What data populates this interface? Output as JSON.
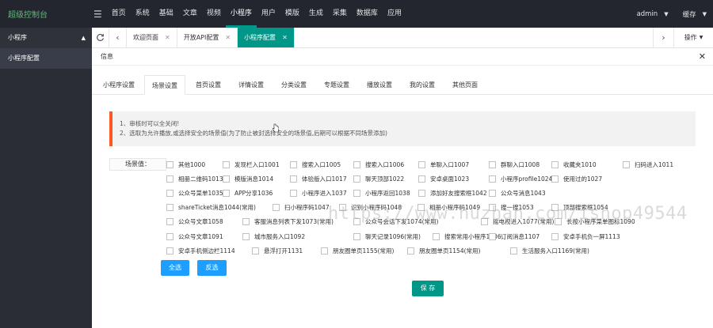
{
  "topbar": {
    "brand": "超级控制台",
    "menu_icon": "menu-icon",
    "nav": [
      {
        "label": "首页"
      },
      {
        "label": "系统"
      },
      {
        "label": "基础"
      },
      {
        "label": "文章"
      },
      {
        "label": "视频"
      },
      {
        "label": "小程序"
      },
      {
        "label": "用户"
      },
      {
        "label": "模版"
      },
      {
        "label": "生成"
      },
      {
        "label": "采集"
      },
      {
        "label": "数据库"
      },
      {
        "label": "应用"
      }
    ],
    "active_nav": "小程序",
    "user": "admin",
    "cache": "缓存"
  },
  "sidebar": {
    "group": "小程序",
    "items": [
      {
        "label": "小程序配置"
      }
    ]
  },
  "tabbar": {
    "tabs": [
      {
        "label": "欢迎页面"
      },
      {
        "label": "开放API配置"
      },
      {
        "label": "小程序配置"
      }
    ],
    "active_tab": "小程序配置",
    "ops": "操作"
  },
  "panel": {
    "title": "信息",
    "subtabs": [
      {
        "label": "小程序设置"
      },
      {
        "label": "场景设置"
      },
      {
        "label": "首页设置"
      },
      {
        "label": "详情设置"
      },
      {
        "label": "分类设置"
      },
      {
        "label": "专题设置"
      },
      {
        "label": "播放设置"
      },
      {
        "label": "我的设置"
      },
      {
        "label": "其他页面"
      }
    ],
    "active_subtab": "场景设置",
    "notice": [
      "1、审核时可以全关闭!",
      "2、选取为允许播放,或选择安全的场景值(为了防止被封选择安全的场景值,后期可以根据不同场景添加)"
    ],
    "field_label": "场景值：",
    "scenes": [
      [
        "其他1000",
        "发现栏入口1001",
        "搜索入口1005",
        "搜索入口1006",
        "单聊入口1007",
        "群聊入口1008",
        "收藏夹1010",
        "扫码进入1011"
      ],
      [
        "相册二维码1013",
        "模版消息1014",
        "体验版入口1017",
        "聊天顶部1022",
        "安卓桌面1023",
        "小程序profile1024",
        "使用过的1027"
      ],
      [
        "公众号菜单1035",
        "APP分享1036",
        "小程序进入1037",
        "小程序返回1038",
        "添加好友搜索框1042",
        "公众号消息1043"
      ],
      [
        "shareTicket消息1044(常用)",
        "扫小程序码1047",
        "识别小程序码1048",
        "相册小程序码1049",
        "搜一搜1053",
        "顶部搜索框1054"
      ],
      [
        "公众号文章1058",
        "客服消息列表下发1073(常用)",
        "公众号会话下发1074(常用)",
        "摇电视进入1077(常用)",
        "长按小程序菜单图标1090"
      ],
      [
        "公众号文章1091",
        "城市服务入口1092",
        "聊天记录1096(常用)",
        "搜索常用小程序1106",
        "订阅消息1107",
        "安卓手机负一屏1113"
      ],
      [
        "安卓手机侧边栏1114",
        "悬浮打开1131",
        "朋友圈单页1155(常用)",
        "朋友圈单页1154(常用)",
        "生活服务入口1169(常用)"
      ]
    ],
    "select_all": "全选",
    "invert": "反选",
    "save": "保 存",
    "watermark": "https://www.huzhan.com/ishop49544"
  },
  "colors": {
    "topbar": "#23262e",
    "accent": "#009688",
    "brand": "#5FB878",
    "notice_border": "#FF5722",
    "button_blue": "#1E9FFF"
  }
}
